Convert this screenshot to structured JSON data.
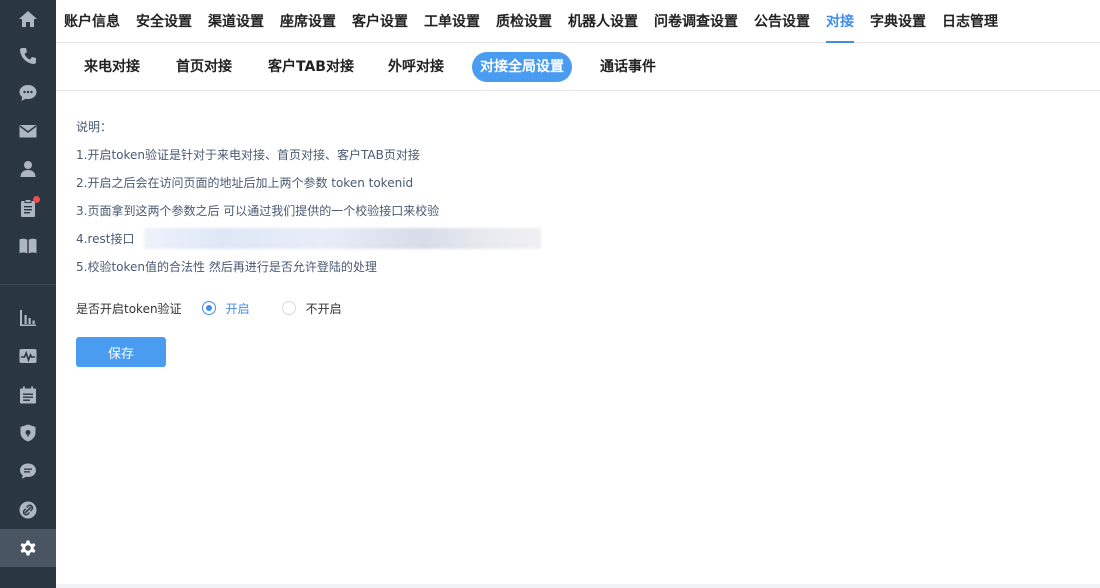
{
  "sidebar": {
    "items": [
      {
        "icon": "home-icon"
      },
      {
        "icon": "phone-icon"
      },
      {
        "icon": "chat-bubble-icon"
      },
      {
        "icon": "mail-icon"
      },
      {
        "icon": "user-icon"
      },
      {
        "icon": "clipboard-icon",
        "badge": true
      },
      {
        "icon": "book-icon"
      },
      {
        "icon": "bar-chart-icon"
      },
      {
        "icon": "pulse-icon"
      },
      {
        "icon": "calendar-list-icon"
      },
      {
        "icon": "shield-icon"
      },
      {
        "icon": "message-icon"
      },
      {
        "icon": "link-icon"
      },
      {
        "icon": "gear-icon",
        "active": true
      }
    ]
  },
  "topnav": {
    "tabs": [
      {
        "label": "账户信息"
      },
      {
        "label": "安全设置"
      },
      {
        "label": "渠道设置"
      },
      {
        "label": "座席设置"
      },
      {
        "label": "客户设置"
      },
      {
        "label": "工单设置"
      },
      {
        "label": "质检设置"
      },
      {
        "label": "机器人设置"
      },
      {
        "label": "问卷调查设置"
      },
      {
        "label": "公告设置"
      },
      {
        "label": "对接",
        "active": true
      },
      {
        "label": "字典设置"
      },
      {
        "label": "日志管理"
      }
    ]
  },
  "subnav": {
    "tabs": [
      {
        "label": "来电对接"
      },
      {
        "label": "首页对接"
      },
      {
        "label": "客户TAB对接"
      },
      {
        "label": "外呼对接"
      },
      {
        "label": "对接全局设置",
        "active": true
      },
      {
        "label": "通话事件"
      }
    ]
  },
  "notes": {
    "title": "说明：",
    "line1": "1.开启token验证是针对于来电对接、首页对接、客户TAB页对接",
    "line2": "2.开启之后会在访问页面的地址后加上两个参数 token tokenid",
    "line3": "3.页面拿到这两个参数之后 可以通过我们提供的一个校验接口来校验",
    "line4": "4.rest接口",
    "line5": "5.校验token值的合法性 然后再进行是否允许登陆的处理"
  },
  "form": {
    "label": "是否开启token验证",
    "options": [
      {
        "label": "开启",
        "checked": true
      },
      {
        "label": "不开启",
        "checked": false
      }
    ],
    "save_label": "保存"
  },
  "colors": {
    "accent": "#3f8ee8",
    "sidebar_bg": "#2b3643",
    "button_bg": "#4a9cf0",
    "badge": "#f04e4e"
  }
}
